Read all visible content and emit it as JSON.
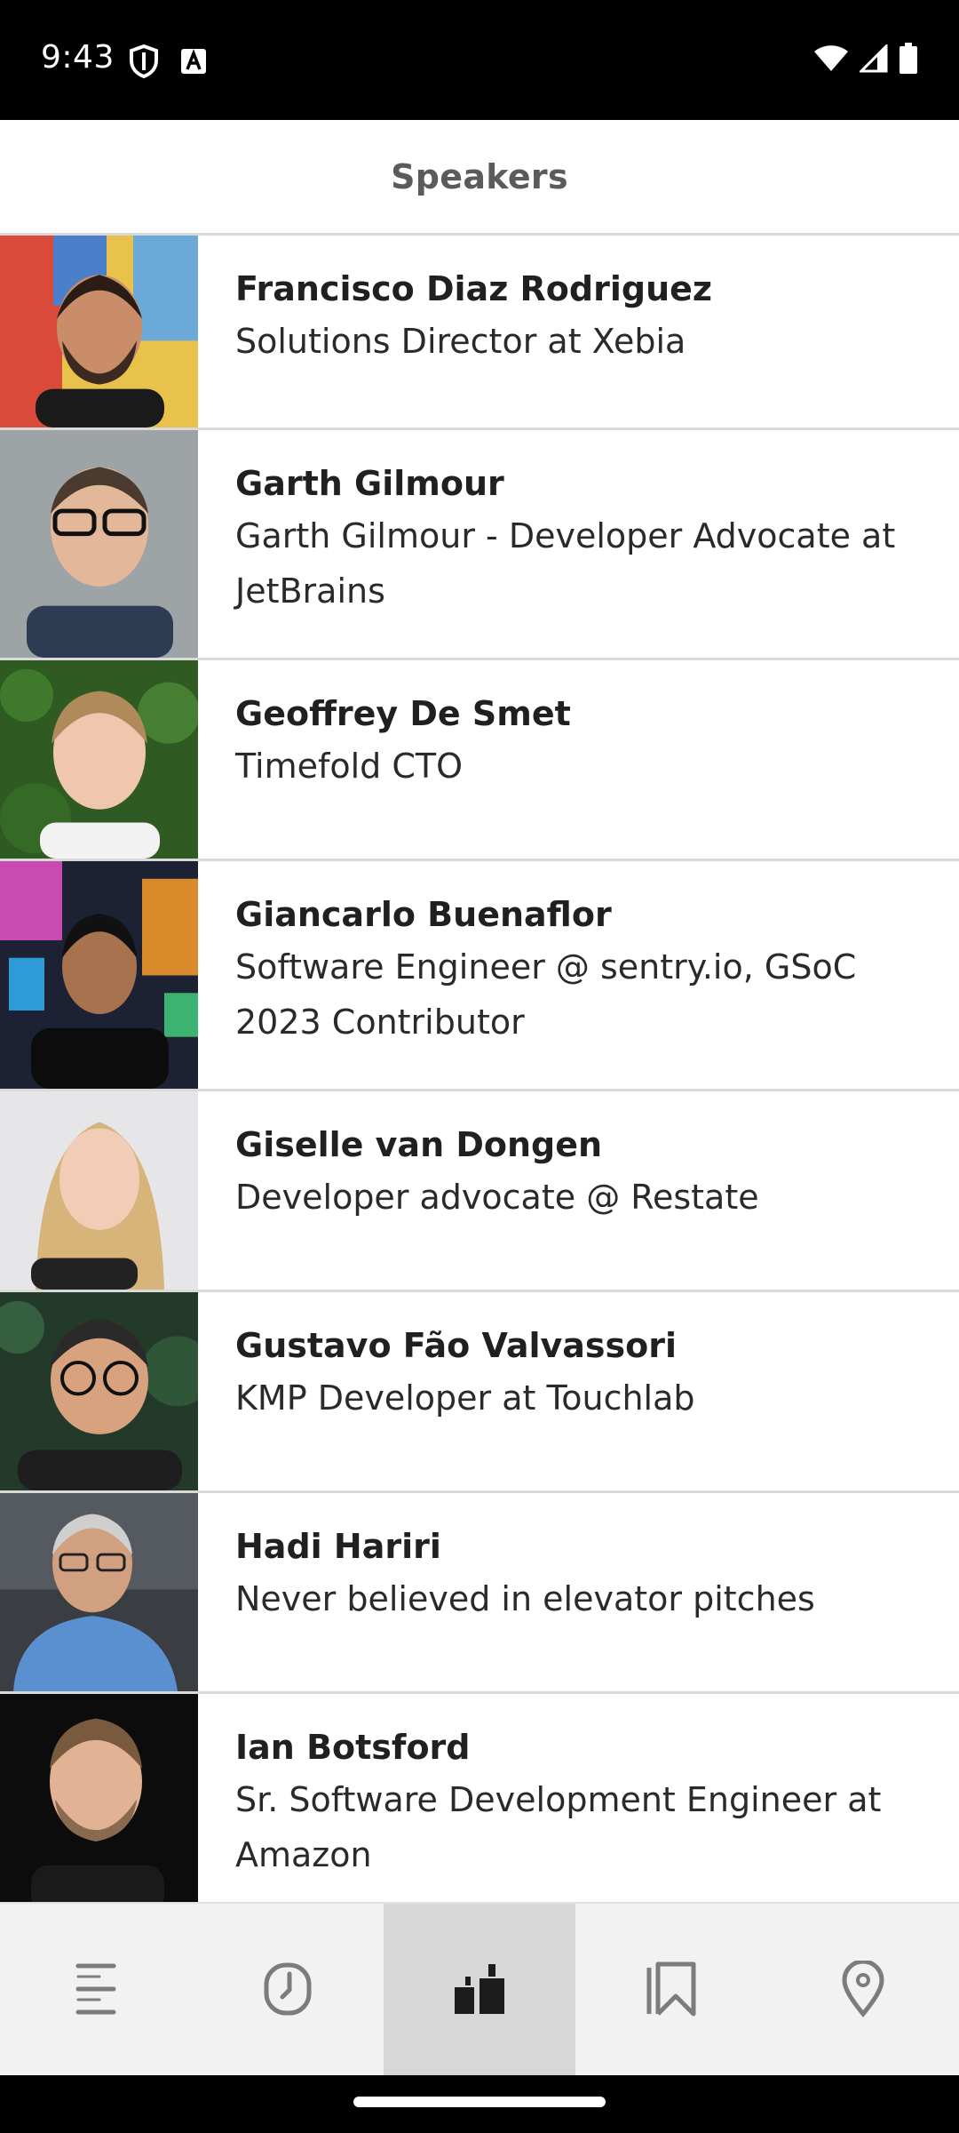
{
  "status_bar": {
    "time": "9:43",
    "left_icons": [
      "shield-icon",
      "font-a-icon"
    ],
    "right_icons": [
      "wifi-icon",
      "signal-icon",
      "battery-icon"
    ]
  },
  "header": {
    "title": "Speakers"
  },
  "speakers": [
    {
      "name": "Francisco Diaz Rodriguez",
      "role": "Solutions Director at Xebia"
    },
    {
      "name": "Garth Gilmour",
      "role": "Garth Gilmour - Developer Advocate at JetBrains"
    },
    {
      "name": "Geoffrey De Smet",
      "role": "Timefold CTO"
    },
    {
      "name": "Giancarlo Buenaflor",
      "role": "Software Engineer @ sentry.io, GSoC 2023 Contributor"
    },
    {
      "name": "Giselle van Dongen",
      "role": "Developer advocate @ Restate"
    },
    {
      "name": "Gustavo Fão Valvassori",
      "role": "KMP Developer at Touchlab"
    },
    {
      "name": "Hadi Hariri",
      "role": "Never believed in elevator pitches"
    },
    {
      "name": "Ian Botsford",
      "role": "Sr. Software Development Engineer at Amazon"
    }
  ],
  "bottom_nav": {
    "items": [
      {
        "icon": "menu-icon",
        "active": false
      },
      {
        "icon": "clock-icon",
        "active": false
      },
      {
        "icon": "speakers-icon",
        "active": true
      },
      {
        "icon": "bookmark-icon",
        "active": false
      },
      {
        "icon": "location-pin-icon",
        "active": false
      }
    ]
  },
  "colors": {
    "status_bar_bg": "#000000",
    "header_text": "#5b5b5b",
    "divider": "#d9d9d9",
    "nav_bg": "#f2f2f2",
    "nav_active_bg": "#d7d7d7"
  }
}
